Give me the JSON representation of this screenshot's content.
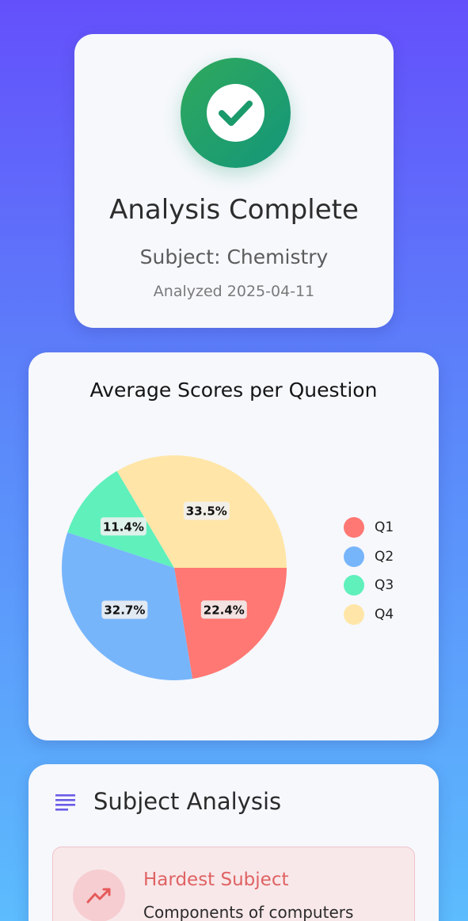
{
  "hero": {
    "title": "Analysis Complete",
    "subject": "Subject: Chemistry",
    "date": "Analyzed 2025-04-11"
  },
  "chart_data": {
    "type": "pie",
    "title": "Average Scores per Question",
    "categories": [
      "Q1",
      "Q2",
      "Q3",
      "Q4"
    ],
    "values": [
      22.4,
      32.7,
      11.4,
      33.5
    ],
    "labels": [
      "22.4%",
      "32.7%",
      "11.4%",
      "33.5%"
    ],
    "colors": [
      "#ff7873",
      "#77b5fb",
      "#5ff0bc",
      "#ffe6a8"
    ],
    "legend_position": "right"
  },
  "analysis": {
    "title": "Subject Analysis",
    "hardest_label": "Hardest Subject",
    "hardest_value": "Components of computers"
  },
  "colors": {
    "success": "#1fa06a",
    "accent": "#6b5ce6",
    "danger": "#e06262"
  },
  "icons": {
    "status": "check-icon",
    "section": "list-icon",
    "hardest": "trending-up-icon"
  }
}
